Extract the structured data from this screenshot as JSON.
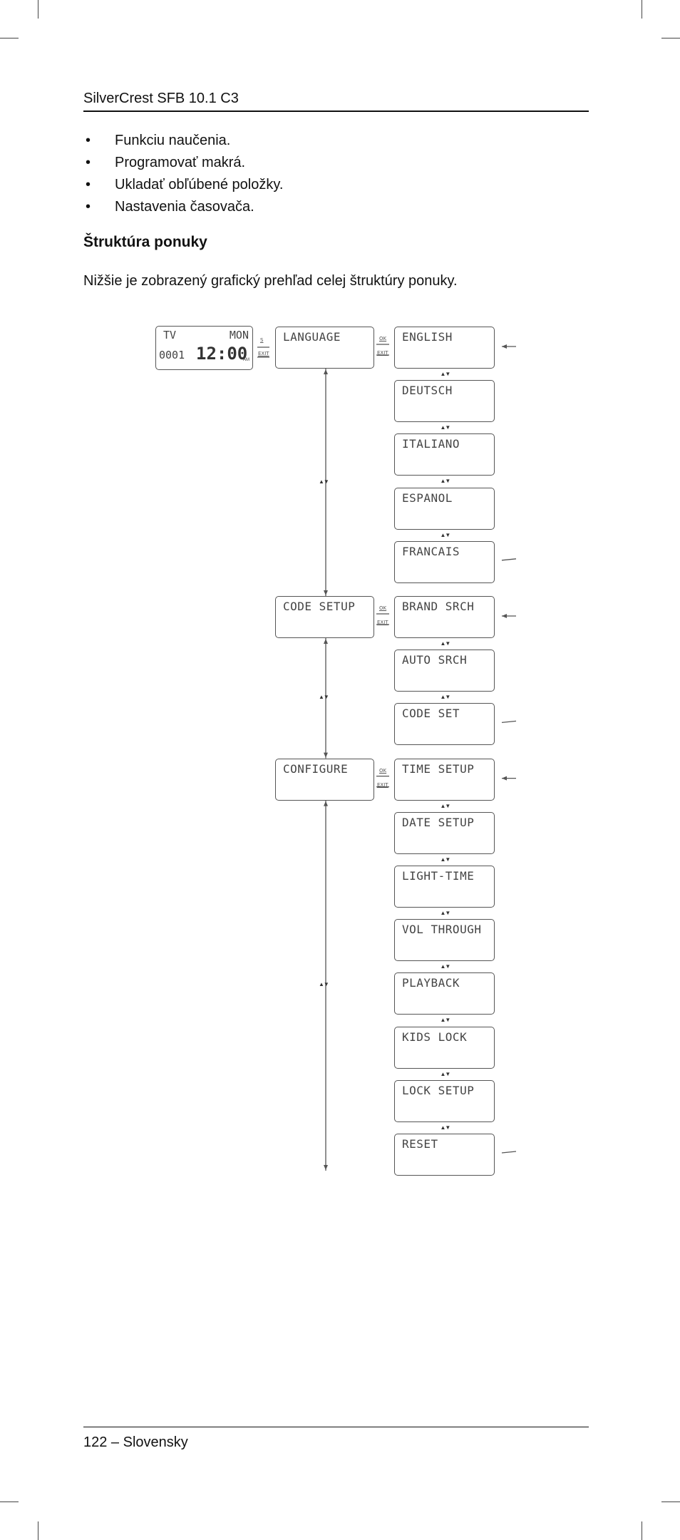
{
  "header": {
    "title": "SilverCrest SFB 10.1 C3"
  },
  "bullets": [
    "Funkciu naučenia.",
    "Programovať makrá.",
    "Ukladať obľúbené položky.",
    "Nastavenia časovača."
  ],
  "section": {
    "heading": "Štruktúra ponuky",
    "intro": "Nižšie je zobrazený grafický prehľad celej štruktúry ponuky."
  },
  "diagram": {
    "screen": {
      "mode": "TV",
      "day": "MON",
      "code": "0001",
      "time": "12:00",
      "ampm": "AM"
    },
    "keys": {
      "enter": "S",
      "ok": "OK",
      "exit": "EXIT",
      "updown": "▲▼"
    },
    "menus": [
      {
        "label": "LANGUAGE",
        "items": [
          "ENGLISH",
          "DEUTSCH",
          "ITALIANO",
          "ESPANOL",
          "FRANCAIS"
        ]
      },
      {
        "label": "CODE SETUP",
        "items": [
          "BRAND SRCH",
          "AUTO SRCH",
          "CODE SET"
        ]
      },
      {
        "label": "CONFIGURE",
        "items": [
          "TIME SETUP",
          "DATE SETUP",
          "LIGHT-TIME",
          "VOL THROUGH",
          "PLAYBACK",
          "KIDS LOCK",
          "LOCK SETUP",
          "RESET"
        ]
      }
    ]
  },
  "footer": {
    "page": "122 – Slovensky"
  }
}
